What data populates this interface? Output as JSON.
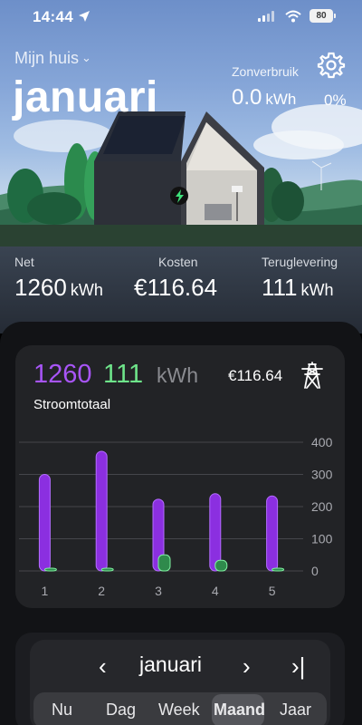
{
  "status_bar": {
    "time": "14:44",
    "battery": "80"
  },
  "header": {
    "home_selector": "Mijn huis",
    "period_title": "januari",
    "settings_icon": "gear-icon",
    "self_consumption": {
      "label": "Zonverbruik",
      "value": "0.0",
      "unit": "kWh",
      "percent": "0%"
    }
  },
  "summary": {
    "net": {
      "label": "Net",
      "value": "1260",
      "unit": "kWh"
    },
    "costs": {
      "label": "Kosten",
      "value": "€116.64"
    },
    "return": {
      "label": "Teruglevering",
      "value": "111",
      "unit": "kWh"
    }
  },
  "card": {
    "net_total": "1260",
    "return_total": "111",
    "unit": "kWh",
    "cost": "€116.64",
    "subtitle": "Stroomtotaal",
    "icon": "power-pylon-icon"
  },
  "chart_data": {
    "type": "bar",
    "categories": [
      "1",
      "2",
      "3",
      "4",
      "5"
    ],
    "series": [
      {
        "values": [
          300,
          372,
          223,
          240,
          233
        ],
        "color": "#9333ea"
      },
      {
        "values": [
          6,
          8,
          50,
          33,
          3
        ],
        "color": "#4ade80"
      }
    ],
    "ylim": [
      0,
      400
    ],
    "yticks": [
      0,
      100,
      200,
      300,
      400
    ],
    "grid": true,
    "legend": "none"
  },
  "navigation": {
    "period_label": "januari",
    "prev_icon": "chevron-left-icon",
    "next_icon": "chevron-right-icon",
    "last_icon": "skip-to-end-icon",
    "segments": [
      "Nu",
      "Dag",
      "Week",
      "Maand",
      "Jaar"
    ],
    "active_segment": "Maand"
  },
  "colors": {
    "net": "#a855f7",
    "return": "#6ee48a",
    "background": "#121316",
    "card": "#222326"
  }
}
